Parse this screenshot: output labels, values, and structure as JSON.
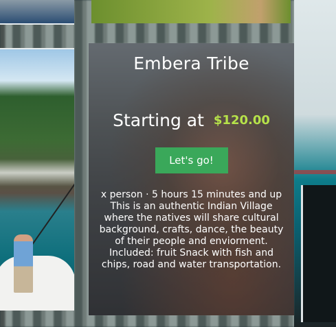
{
  "card": {
    "title": "Embera Tribe",
    "price_lead": "Starting at",
    "price": "$120.00",
    "cta_label": "Let's go!",
    "meta": "x person · 5 hours 15 minutes and up",
    "description": "This is an authentic Indian Village where the natives will share cultural background, crafts, dance, the beauty of their people and enviorment. Included: fruit Snack with fish and chips, road and water transportation."
  },
  "colors": {
    "price": "#b6e24a",
    "cta_background": "#3aa85a",
    "text": "#ffffff"
  }
}
